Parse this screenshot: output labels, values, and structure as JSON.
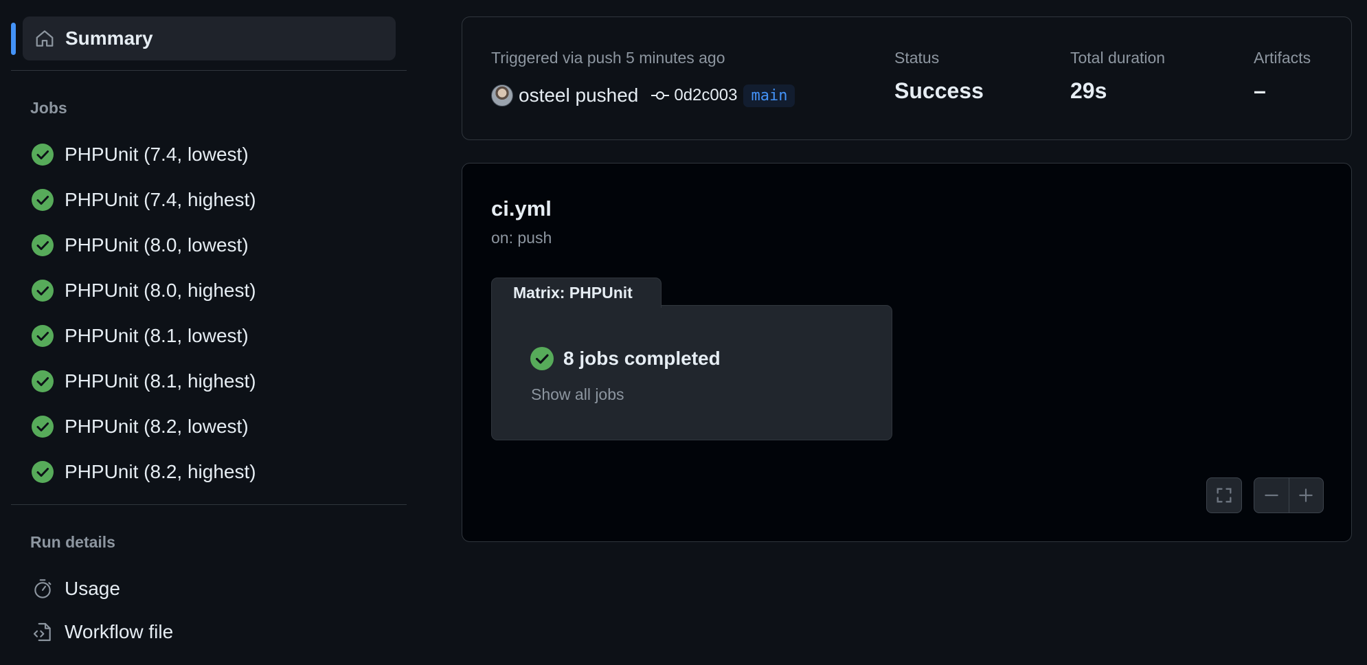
{
  "sidebar": {
    "summary_label": "Summary",
    "jobs_title": "Jobs",
    "jobs": [
      {
        "label": "PHPUnit (7.4, lowest)",
        "status": "success"
      },
      {
        "label": "PHPUnit (7.4, highest)",
        "status": "success"
      },
      {
        "label": "PHPUnit (8.0, lowest)",
        "status": "success"
      },
      {
        "label": "PHPUnit (8.0, highest)",
        "status": "success"
      },
      {
        "label": "PHPUnit (8.1, lowest)",
        "status": "success"
      },
      {
        "label": "PHPUnit (8.1, highest)",
        "status": "success"
      },
      {
        "label": "PHPUnit (8.2, lowest)",
        "status": "success"
      },
      {
        "label": "PHPUnit (8.2, highest)",
        "status": "success"
      }
    ],
    "run_details_title": "Run details",
    "details": [
      {
        "label": "Usage",
        "icon": "stopwatch-icon"
      },
      {
        "label": "Workflow file",
        "icon": "file-code-icon"
      }
    ]
  },
  "run": {
    "trigger_text": "Triggered via push 5 minutes ago",
    "pusher": "osteel pushed",
    "commit_sha": "0d2c003",
    "branch": "main",
    "status_label": "Status",
    "status_value": "Success",
    "duration_label": "Total duration",
    "duration_value": "29s",
    "artifacts_label": "Artifacts",
    "artifacts_value": "–"
  },
  "workflow": {
    "file": "ci.yml",
    "trigger": "on: push",
    "matrix_label": "Matrix: PHPUnit",
    "jobs_completed": "8 jobs completed",
    "show_all_jobs": "Show all jobs"
  },
  "colors": {
    "background": "#0d1117",
    "graph_background": "#010409",
    "accent": "#4493f8",
    "success": "#57ab5a",
    "muted_text": "#8d96a0",
    "border": "#30363d"
  }
}
